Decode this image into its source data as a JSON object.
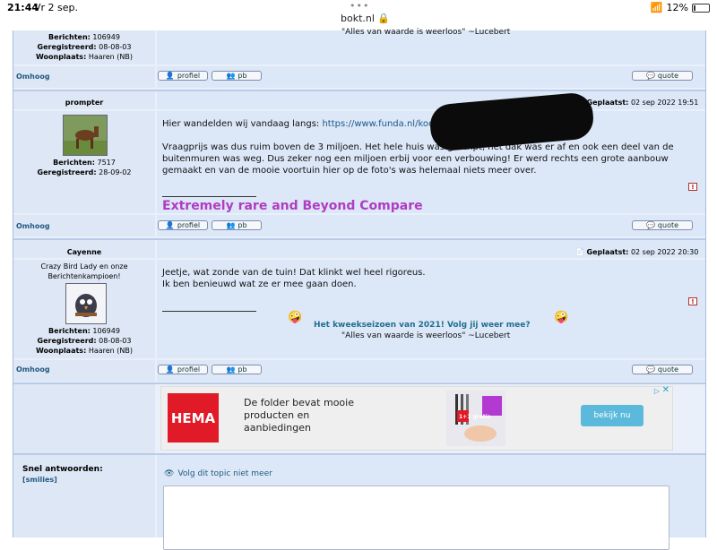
{
  "status_bar": {
    "time": "21:44",
    "date": "Vr 2 sep.",
    "url": "bokt.nl",
    "battery": "12%"
  },
  "top_post": {
    "meta": [
      {
        "label": "Berichten:",
        "value": "106949"
      },
      {
        "label": "Geregistreerd:",
        "value": "08-08-03"
      },
      {
        "label": "Woonplaats:",
        "value": "Haaren (NB)"
      }
    ],
    "signature_quote": "\"Alles van waarde is weerloos\" ~Lucebert"
  },
  "buttons": {
    "omhoog": "Omhoog",
    "profiel": "profiel",
    "pb": "pb",
    "quote": "quote"
  },
  "post_prompter": {
    "author": "prompter",
    "posted_label": "Geplaatst:",
    "posted_date": "02 sep 2022 19:51",
    "line1_prefix": "Hier wandelden wij vandaag langs:",
    "link": "https://www.funda.nl/koop/verkocht/rott ... paasei-41/",
    "body": "Vraagprijs was dus ruim boven de 3 miljoen. Het hele huis was gestript, het dak was er af en ook een deel van de buitenmuren was weg. Dus zeker nog een miljoen erbij voor een verbouwing! Er werd rechts een grote aanbouw gemaakt en van de mooie voortuin hier op de foto's was helemaal niets meer over.",
    "meta": [
      {
        "label": "Berichten:",
        "value": "7517"
      },
      {
        "label": "Geregistreerd:",
        "value": "28-09-02"
      }
    ],
    "signature": "Extremely rare and Beyond Compare"
  },
  "post_cayenne": {
    "author": "Cayenne",
    "user_title": "Crazy Bird Lady en onze Berichtenkampioen!",
    "posted_label": "Geplaatst:",
    "posted_date": "02 sep 2022 20:30",
    "line1": "Jeetje, wat zonde van de tuin! Dat klinkt wel heel rigoreus.",
    "line2": "Ik ben benieuwd wat ze er mee gaan doen.",
    "meta": [
      {
        "label": "Berichten:",
        "value": "106949"
      },
      {
        "label": "Geregistreerd:",
        "value": "08-08-03"
      },
      {
        "label": "Woonplaats:",
        "value": "Haaren (NB)"
      }
    ],
    "signature_link": "Het kweekseizoen van 2021! Volg jij weer mee?",
    "signature_quote": "\"Alles van waarde is weerloos\" ~Lucebert"
  },
  "ad": {
    "brand": "HEMA",
    "line1": "De folder bevat mooie",
    "line2": "producten en",
    "line3": "aanbiedingen",
    "button": "bekijk nu",
    "badge": "1+1 gratis"
  },
  "reply": {
    "title": "Snel antwoorden:",
    "smilies": "[smilies]",
    "follow": "Volg dit topic niet meer"
  },
  "colors": {
    "signature_purple": "#b03cc4",
    "link_blue": "#226f8f",
    "hema_red": "#e11a27"
  }
}
